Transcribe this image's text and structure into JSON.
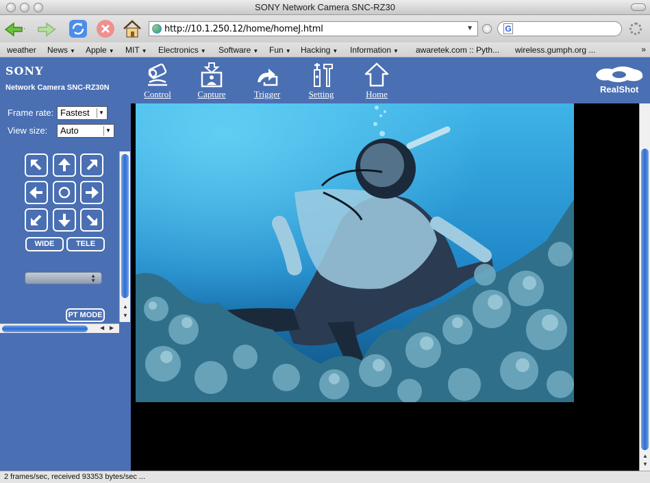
{
  "window": {
    "title": "SONY Network Camera SNC-RZ30"
  },
  "toolbar": {
    "url": "http://10.1.250.12/home/homeJ.html",
    "search_engine_icon": "G"
  },
  "bookmarks": [
    {
      "label": "weather",
      "menu": false
    },
    {
      "label": "News",
      "menu": true
    },
    {
      "label": "Apple",
      "menu": true
    },
    {
      "label": "MIT",
      "menu": true
    },
    {
      "label": "Electronics",
      "menu": true
    },
    {
      "label": "Software",
      "menu": true
    },
    {
      "label": "Fun",
      "menu": true
    },
    {
      "label": "Hacking",
      "menu": true
    },
    {
      "label": "Information",
      "menu": true
    },
    {
      "label": "awaretek.com :: Pyth...",
      "menu": false
    },
    {
      "label": "wireless.gumph.org ...",
      "menu": false
    }
  ],
  "bookmarks_more": "»",
  "header": {
    "brand": "SONY",
    "camera_name": "Network Camera SNC-RZ30N",
    "nav": [
      {
        "label": "Control",
        "icon": "camera-icon"
      },
      {
        "label": "Capture",
        "icon": "capture-icon"
      },
      {
        "label": "Trigger",
        "icon": "trigger-icon"
      },
      {
        "label": "Setting",
        "icon": "setting-icon"
      },
      {
        "label": "Home",
        "icon": "home-icon"
      }
    ],
    "realshot_label": "RealShot"
  },
  "controls": {
    "frame_rate_label": "Frame rate:",
    "frame_rate_value": "Fastest",
    "view_size_label": "View size:",
    "view_size_value": "Auto",
    "wide_label": "WIDE",
    "tele_label": "TELE",
    "preset_value": "",
    "pt_mode_label": "PT MODE"
  },
  "status": {
    "text": "2 frames/sec, received 93353 bytes/sec ..."
  },
  "colors": {
    "panel": "#4a6fb3",
    "video_bg": "#000000"
  }
}
